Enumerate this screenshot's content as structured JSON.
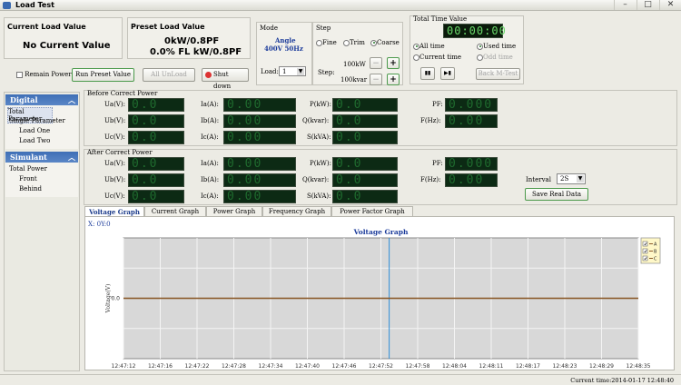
{
  "window": {
    "title": "Load Test",
    "minimize": "–",
    "maximize": "□",
    "close": "✕"
  },
  "current_load": {
    "title": "Current Load Value",
    "value": "No Current Value"
  },
  "preset_load": {
    "title": "Preset Load Value",
    "line1": "0kW/0.8PF",
    "line2": "0.0% FL kW/0.8PF"
  },
  "controls": {
    "remain_power": "Remain Power",
    "run_preset": "Run Preset Value",
    "all_unload": "All UnLoad",
    "shut_down": "Shut down"
  },
  "mode": {
    "title": "Mode",
    "value": "Angle",
    "line2": "400V  50Hz",
    "load_label": "Load:",
    "load_value": "1"
  },
  "step": {
    "title": "Step",
    "fine": "Fine",
    "trim": "Trim",
    "coarse": "Coarse",
    "step_label": "Step:",
    "kw": "100kW",
    "kvar": "100kvar",
    "minus": "−",
    "plus": "+"
  },
  "timer": {
    "title": "Total Time Value",
    "display": "00:00:00",
    "all_time": "All time",
    "current_time": "Current time",
    "used_time": "Used time",
    "odd_time": "Odd time",
    "play": "▮▮",
    "next": "▶▮",
    "back": "Back M-Test"
  },
  "sidebar": {
    "digital": "Digital",
    "digital_items": [
      "Total Parameter",
      "Single Parameter",
      "Load One",
      "Load Two"
    ],
    "simulant": "Simulant",
    "simulant_items": [
      "Total Power",
      "Front",
      "Behind"
    ]
  },
  "before": {
    "title": "Before Correct Power",
    "ua": "Ua(V):",
    "ub": "Ub(V):",
    "uc": "Uc(V):",
    "ia": "Ia(A):",
    "ib": "Ib(A):",
    "ic": "Ic(A):",
    "p": "P(kW):",
    "q": "Q(kvar):",
    "s": "S(kVA):",
    "pf": "PF:",
    "f": "F(Hz):",
    "v_val": "0.0",
    "i_val": "0.00",
    "pqs_val": "0.0",
    "pf_val": "0.000",
    "f_val": "0.00"
  },
  "after": {
    "title": "After Correct Power",
    "ua": "Ua(V):",
    "ub": "Ub(V):",
    "uc": "Uc(V):",
    "ia": "Ia(A):",
    "ib": "Ib(A):",
    "ic": "Ic(A):",
    "p": "P(kW):",
    "q": "Q(kvar):",
    "s": "S(kVA):",
    "pf": "PF:",
    "f": "F(Hz):",
    "v_val": "0.0",
    "i_val": "0.00",
    "pqs_val": "0.0",
    "pf_val": "0.000",
    "f_val": "0.00",
    "interval_label": "Interval",
    "interval_value": "2S",
    "save": "Save Real Data"
  },
  "tabs": [
    "Voltage Graph",
    "Current Graph",
    "Power Graph",
    "Frequency Graph",
    "Power Factor Graph"
  ],
  "graph": {
    "readout": "X: 0Y:0",
    "title": "Voltage Graph",
    "ylabel": "Voltage(V)",
    "ytick": "0.0",
    "xticks": [
      "12:47:12",
      "12:47:16",
      "12:47:22",
      "12:47:28",
      "12:47:34",
      "12:47:40",
      "12:47:46",
      "12:47:52",
      "12:47:58",
      "12:48:04",
      "12:48:11",
      "12:48:17",
      "12:48:23",
      "12:48:29",
      "12:48:35"
    ],
    "legend": [
      "A",
      "B",
      "C"
    ]
  },
  "chart_data": {
    "type": "line",
    "title": "Voltage Graph",
    "xlabel": "",
    "ylabel": "Voltage(V)",
    "categories": [
      "12:47:12",
      "12:47:16",
      "12:47:22",
      "12:47:28",
      "12:47:34",
      "12:47:40",
      "12:47:46",
      "12:47:52",
      "12:47:58",
      "12:48:04",
      "12:48:11",
      "12:48:17",
      "12:48:23",
      "12:48:29",
      "12:48:35"
    ],
    "series": [
      {
        "name": "A",
        "values": [
          0,
          0,
          0,
          0,
          0,
          0,
          0,
          0,
          0,
          0,
          0,
          0,
          0,
          0,
          0
        ]
      },
      {
        "name": "B",
        "values": [
          0,
          0,
          0,
          0,
          0,
          0,
          0,
          0,
          0,
          0,
          0,
          0,
          0,
          0,
          0
        ]
      },
      {
        "name": "C",
        "values": [
          0,
          0,
          0,
          0,
          0,
          0,
          0,
          0,
          0,
          0,
          0,
          0,
          0,
          0,
          0
        ]
      }
    ],
    "grid": true,
    "legend": "top-right"
  },
  "status": {
    "text": "Current time:2014-01-17  12:48:40"
  },
  "colors": {
    "lcd_bg": "#0c2a14",
    "lcd_text": "#1f6a2e",
    "sidebar": "#3f6fb6",
    "plot_bg": "#d8d8d8",
    "series_line": "#8a5a2a"
  }
}
